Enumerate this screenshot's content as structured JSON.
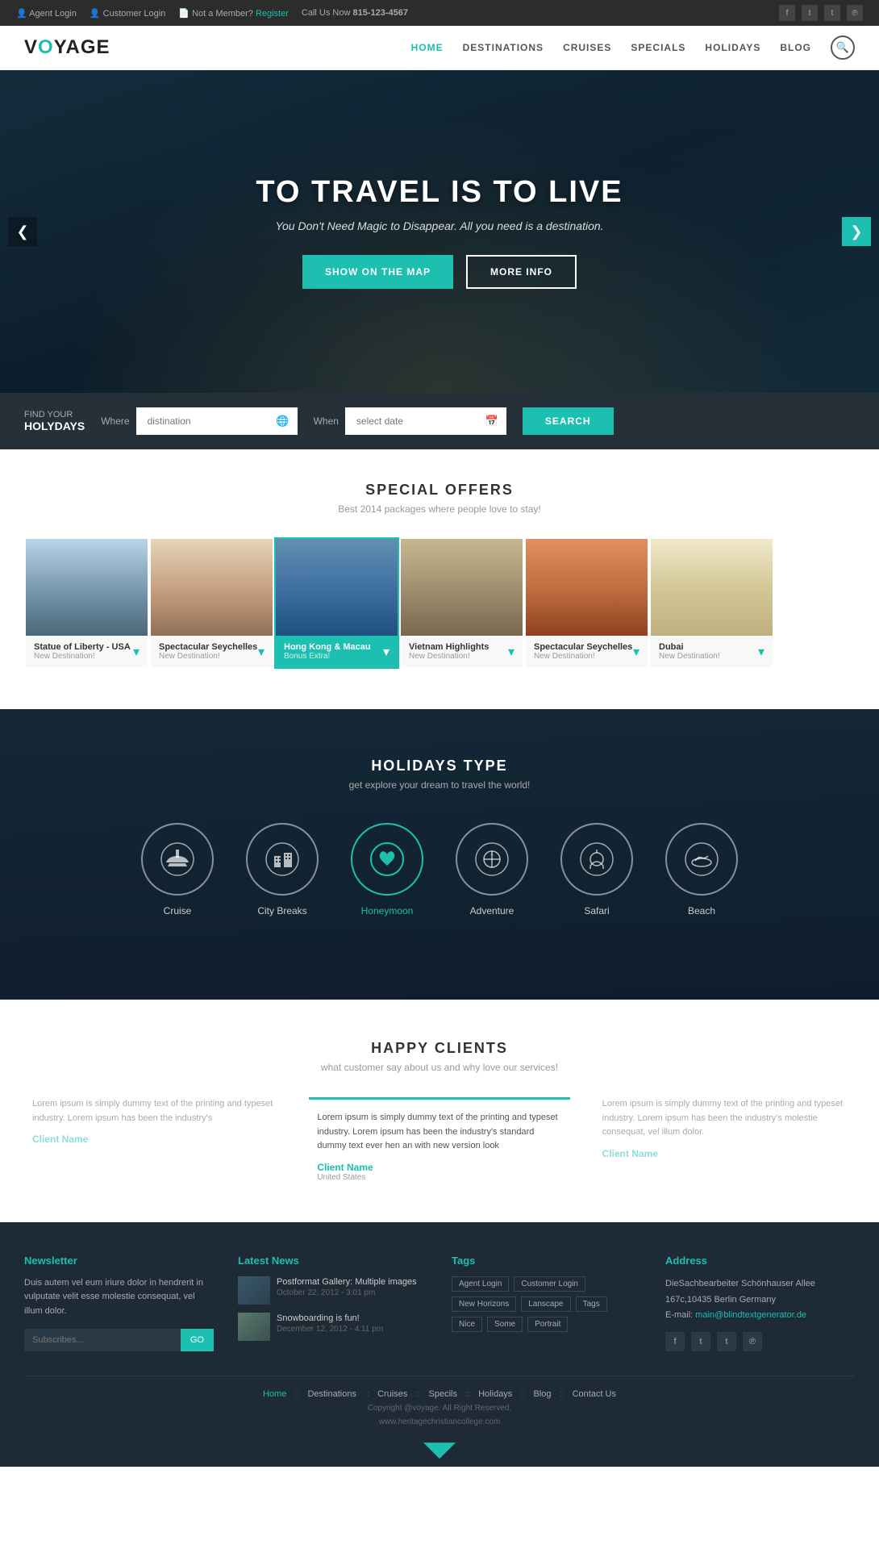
{
  "topbar": {
    "agent_login": "Agent Login",
    "customer_login": "Customer Login",
    "not_member": "Not a Member?",
    "register": "Register",
    "call_us": "Call Us Now",
    "phone": "815-123-4567"
  },
  "navbar": {
    "logo_vo": "VO",
    "logo_yage": "YAGE",
    "links": [
      {
        "label": "HOME",
        "active": true
      },
      {
        "label": "DESTINATIONS",
        "active": false
      },
      {
        "label": "CRUISES",
        "active": false
      },
      {
        "label": "SPECIALS",
        "active": false
      },
      {
        "label": "HOLIDAYS",
        "active": false
      },
      {
        "label": "BLOG",
        "active": false
      }
    ]
  },
  "hero": {
    "title": "TO TRAVEL IS TO LIVE",
    "subtitle": "You Don't Need Magic to Disappear. All you need is a destination.",
    "btn_show": "SHOW ON THE MAP",
    "btn_more": "MORE INFO",
    "arrow_left": "❮",
    "arrow_right": "❯"
  },
  "search": {
    "find_label": "FIND YOUR",
    "holidays_label": "HOLYDAYS",
    "where_label": "Where",
    "where_placeholder": "distination",
    "when_label": "When",
    "when_placeholder": "select date",
    "search_btn": "Search"
  },
  "special_offers": {
    "title": "SPECIAL OFFERS",
    "subtitle": "Best 2014 packages where people love to stay!",
    "cards": [
      {
        "name": "Statue of Liberty - USA",
        "sub": "New Destination!",
        "active": false
      },
      {
        "name": "Spectacular Seychelles",
        "sub": "New Destination!",
        "active": false
      },
      {
        "name": "Hong Kong & Macau",
        "sub": "Bonus Extra!",
        "active": true
      },
      {
        "name": "Vietnam Highlights",
        "sub": "New Destination!",
        "active": false
      },
      {
        "name": "Spectacular Seychelles",
        "sub": "New Destination!",
        "active": false
      },
      {
        "name": "Dubai",
        "sub": "New Destination!",
        "active": false
      }
    ]
  },
  "holidays_type": {
    "title": "HOLIDAYS TYPE",
    "subtitle": "get explore your dream to travel the world!",
    "types": [
      {
        "label": "Cruise",
        "active": false
      },
      {
        "label": "City Breaks",
        "active": false
      },
      {
        "label": "Honeymoon",
        "active": true
      },
      {
        "label": "Adventure",
        "active": false
      },
      {
        "label": "Safari",
        "active": false
      },
      {
        "label": "Beach",
        "active": false
      }
    ]
  },
  "happy_clients": {
    "title": "HAPPY CLIENTS",
    "subtitle": "what customer say about us and why love our services!",
    "testimonials": [
      {
        "text": "Lorem ipsum is simply dummy text of the printing and typeset industry. Lorem ipsum has been the industry's",
        "name": "Client Name",
        "location": "",
        "center": false
      },
      {
        "text": "Lorem ipsum is simply dummy text of the printing and typeset industry. Lorem ipsum has been the industry's standard dummy text ever hen an with new version look",
        "name": "Client Name",
        "location": "United States",
        "center": true
      },
      {
        "text": "Lorem ipsum is simply dummy text of the printing and typeset industry. Lorem ipsum has been the industry's molestie consequat, vel illum dolor.",
        "name": "Client Name",
        "location": "",
        "center": false
      }
    ]
  },
  "footer": {
    "newsletter": {
      "title": "Newsletter",
      "text": "Duis autem vel eum iriure dolor in hendrerit in vulputate velit esse molestie consequat, vel illum dolor.",
      "placeholder": "Subscribes...",
      "btn": "GO"
    },
    "latest_news": {
      "title": "Latest News",
      "items": [
        {
          "title": "Postformat Gallery: Multiple images",
          "date": "October 22, 2012 - 3:01 pm"
        },
        {
          "title": "Snowboarding is fun!",
          "date": "December 12, 2012 - 4:11 pm"
        }
      ]
    },
    "tags": {
      "title": "Tags",
      "items": [
        "Agent Login",
        "Customer Login",
        "New Horizons",
        "Lanscape",
        "Tags",
        "Nice",
        "Some",
        "Portrait"
      ]
    },
    "address": {
      "title": "Address",
      "line1": "DieSachbearbeiter Schönhauser Allee",
      "line2": "167c,10435 Berlin Germany",
      "email_label": "E-mail:",
      "email": "main@blindtextgenerator.de"
    },
    "bottom_links": [
      "Home",
      "Destinations",
      "Cruises",
      "Specils",
      "Holidays",
      "Blog",
      "Contact Us"
    ],
    "copyright": "Copyright @voyage. All Right Reserved.",
    "website": "www.heritagechristiancollege.com"
  }
}
